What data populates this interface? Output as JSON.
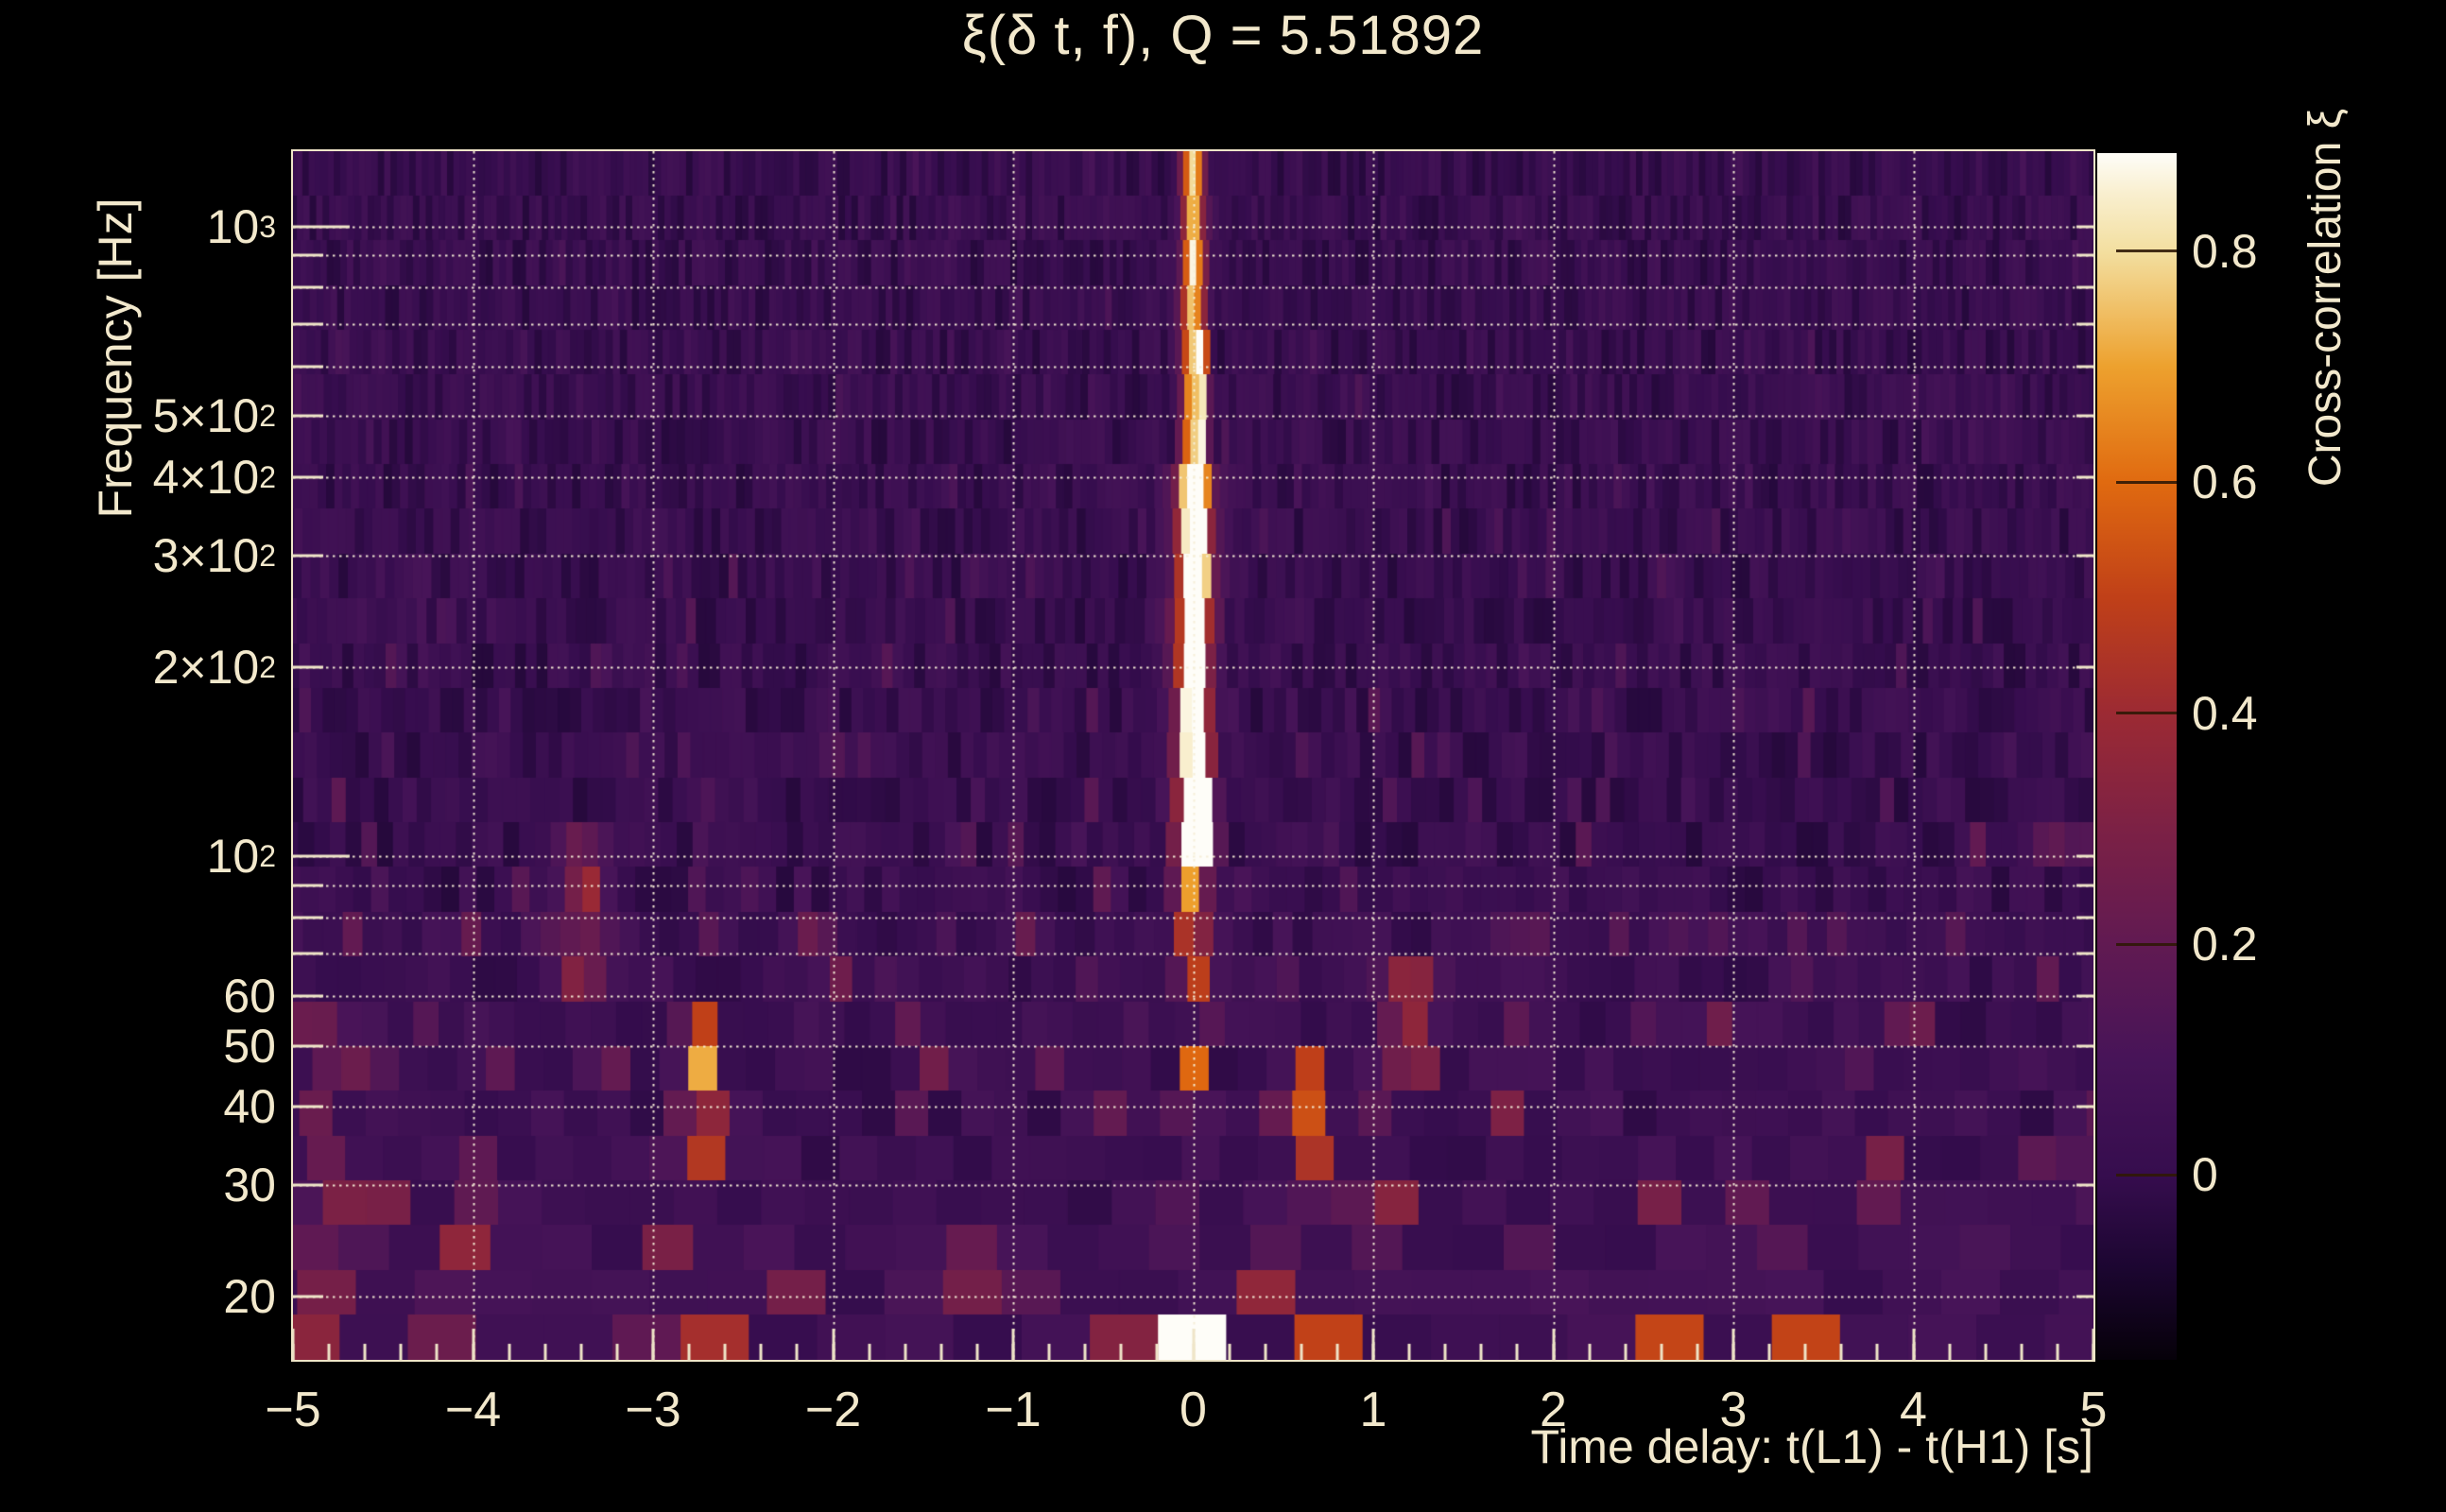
{
  "chart_data": {
    "type": "heatmap",
    "title": "ξ(δ t, f), Q = 5.51892",
    "q_value": 5.51892,
    "xlabel": "Time delay: t(L1) - t(H1) [s]",
    "ylabel": "Frequency [Hz]",
    "colorbar_label": "Cross-correlation ξ",
    "x_range": [
      -5,
      5
    ],
    "x_major_ticks": [
      {
        "t": -5,
        "label": "−5"
      },
      {
        "t": -4,
        "label": "−4"
      },
      {
        "t": -3,
        "label": "−3"
      },
      {
        "t": -2,
        "label": "−2"
      },
      {
        "t": -1,
        "label": "−1"
      },
      {
        "t": 0,
        "label": "0"
      },
      {
        "t": 1,
        "label": "1"
      },
      {
        "t": 2,
        "label": "2"
      },
      {
        "t": 3,
        "label": "3"
      },
      {
        "t": 4,
        "label": "4"
      },
      {
        "t": 5,
        "label": "5"
      }
    ],
    "x_minor_step": 0.2,
    "y_scale": "log",
    "y_range": [
      15.85,
      1318
    ],
    "y_ticks": [
      {
        "f": 1000,
        "base": "10",
        "exp": "3",
        "decade": true
      },
      {
        "f": 500,
        "base": "5×10",
        "exp": "2"
      },
      {
        "f": 400,
        "base": "4×10",
        "exp": "2"
      },
      {
        "f": 300,
        "base": "3×10",
        "exp": "2"
      },
      {
        "f": 200,
        "base": "2×10",
        "exp": "2"
      },
      {
        "f": 100,
        "base": "10",
        "exp": "2",
        "decade": true
      },
      {
        "f": 60,
        "base": "60"
      },
      {
        "f": 50,
        "base": "50"
      },
      {
        "f": 40,
        "base": "40"
      },
      {
        "f": 30,
        "base": "30"
      },
      {
        "f": 20,
        "base": "20"
      }
    ],
    "y_gridlines": [
      20,
      30,
      40,
      50,
      60,
      70,
      80,
      90,
      100,
      200,
      300,
      400,
      500,
      600,
      700,
      800,
      900,
      1000
    ],
    "grid": true,
    "z_range": [
      -0.16,
      0.885
    ],
    "colorbar_ticks": [
      {
        "v": 0.8,
        "label": "0.8"
      },
      {
        "v": 0.6,
        "label": "0.6"
      },
      {
        "v": 0.4,
        "label": "0.4"
      },
      {
        "v": 0.2,
        "label": "0.2"
      },
      {
        "v": 0.0,
        "label": "0"
      }
    ],
    "palette": [
      {
        "v": -0.16,
        "c": "#060109"
      },
      {
        "v": -0.08,
        "c": "#1c0631"
      },
      {
        "v": 0.0,
        "c": "#360d4e"
      },
      {
        "v": 0.1,
        "c": "#471458"
      },
      {
        "v": 0.2,
        "c": "#611a52"
      },
      {
        "v": 0.3,
        "c": "#7c2145"
      },
      {
        "v": 0.4,
        "c": "#9c2a33"
      },
      {
        "v": 0.5,
        "c": "#c04018"
      },
      {
        "v": 0.6,
        "c": "#e06a10"
      },
      {
        "v": 0.7,
        "c": "#eda12e"
      },
      {
        "v": 0.8,
        "c": "#f3dfa0"
      },
      {
        "v": 0.85,
        "c": "#f9efcf"
      },
      {
        "v": 0.885,
        "c": "#fefdf8"
      }
    ],
    "rows": 27,
    "noise": {
      "seed": 11,
      "base_level": 0.0,
      "spike_prob": 0.16
    },
    "ridge": {
      "t0": 0.0,
      "sigma": 0.045,
      "amp_high_f": 0.74,
      "solid_above_hz": 85,
      "glow_sigma": 0.09,
      "glow_amp": 0.4,
      "second_line": {
        "t": 0.055,
        "sigma": 0.018,
        "amp": 0.5,
        "f1": 95,
        "f2": 700
      },
      "strong_low_bands": [
        [
          60,
          80
        ],
        [
          36,
          46
        ],
        [
          26,
          33
        ],
        [
          15.8,
          18.5
        ]
      ]
    },
    "hotspots": [
      {
        "t": -4.84,
        "f1": 17,
        "f2": 60,
        "a": 0.2,
        "w": 0.06
      },
      {
        "t": -4.06,
        "f1": 20,
        "f2": 34,
        "a": 0.28,
        "w": 0.07
      },
      {
        "t": -3.4,
        "f1": 60,
        "f2": 110,
        "a": 0.24,
        "w": 0.12
      },
      {
        "t": -3.18,
        "f1": 15.8,
        "f2": 18,
        "a": 0.5,
        "w": 0.09
      },
      {
        "t": -2.74,
        "f1": 31,
        "f2": 58,
        "a": 0.45,
        "w": 0.07
      },
      {
        "t": -2.62,
        "f1": 15.8,
        "f2": 19,
        "a": 0.35,
        "w": 0.08
      },
      {
        "t": -1.13,
        "f1": 19,
        "f2": 27,
        "a": 0.48,
        "w": 0.07
      },
      {
        "t": -0.45,
        "f1": 15.8,
        "f2": 17.5,
        "a": 0.32,
        "w": 0.15
      },
      {
        "t": 0.33,
        "f1": 17.5,
        "f2": 24,
        "a": 0.55,
        "w": 0.06
      },
      {
        "t": 0.62,
        "f1": 33,
        "f2": 48,
        "a": 0.5,
        "w": 0.07
      },
      {
        "t": 0.75,
        "f1": 15.8,
        "f2": 18,
        "a": 0.4,
        "w": 0.1
      },
      {
        "t": 1.21,
        "f1": 43,
        "f2": 70,
        "a": 0.33,
        "w": 0.1
      },
      {
        "t": 2.53,
        "f1": 15.8,
        "f2": 18.5,
        "a": 0.62,
        "w": 0.07
      },
      {
        "t": 2.7,
        "f1": 15.8,
        "f2": 17.5,
        "a": 0.4,
        "w": 0.06
      },
      {
        "t": 3.39,
        "f1": 15.8,
        "f2": 18.5,
        "a": 0.5,
        "w": 0.06
      },
      {
        "t": 3.55,
        "f1": 15.8,
        "f2": 19,
        "a": 0.42,
        "w": 0.06
      },
      {
        "t": 4.32,
        "f1": 15.8,
        "f2": 20,
        "a": 0.38,
        "w": 0.07
      }
    ],
    "colors": {
      "background": "#000000",
      "text": "#f2e8cc",
      "axis_frame": "#efe5c8",
      "gridline": "rgba(245,238,215,0.95)"
    }
  }
}
